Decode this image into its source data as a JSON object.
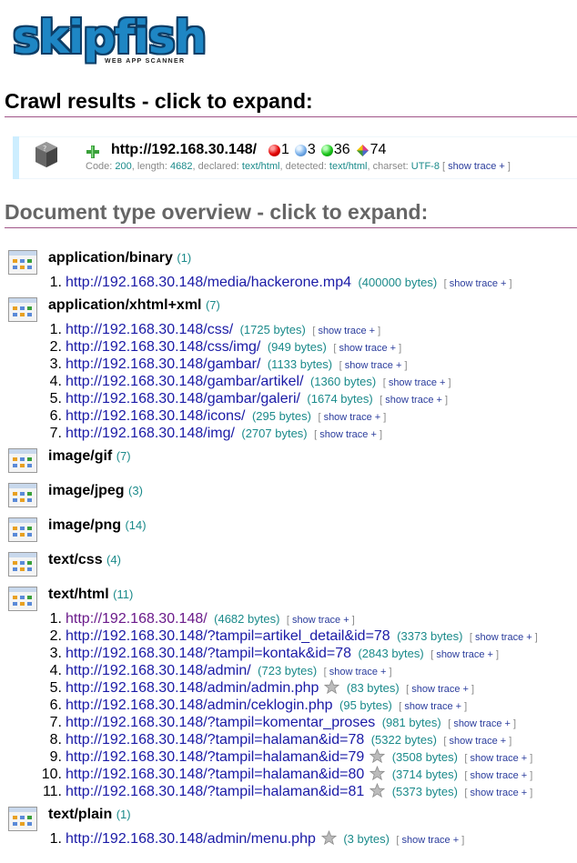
{
  "logo": {
    "name": "skipfish",
    "tagline": "WEB APP SCANNER"
  },
  "crawl": {
    "title": "Crawl results - click to expand:",
    "url": "http://192.168.30.148/",
    "counts": {
      "high": "1",
      "medium": "3",
      "low": "36",
      "notes": "74"
    },
    "meta": {
      "code_label": "Code: ",
      "code": "200",
      "length_label": ", length: ",
      "length": "4682",
      "declared_label": ", declared: ",
      "declared": "text/html",
      "detected_label": ", detected: ",
      "detected": "text/html",
      "charset_label": ", charset: ",
      "charset": "UTF-8"
    },
    "trace_open": "[ ",
    "trace_label": "show trace +",
    "trace_close": " ]"
  },
  "doc": {
    "title": "Document type overview - click to expand:",
    "groups": [
      {
        "type": "application/binary",
        "count": "(1)",
        "items": [
          {
            "n": "1.",
            "url": "http://192.168.30.148/media/hackerone.mp4",
            "size": "(400000 bytes)"
          }
        ]
      },
      {
        "type": "application/xhtml+xml",
        "count": "(7)",
        "items": [
          {
            "n": "1.",
            "url": "http://192.168.30.148/css/",
            "size": "(1725 bytes)"
          },
          {
            "n": "2.",
            "url": "http://192.168.30.148/css/img/",
            "size": "(949 bytes)"
          },
          {
            "n": "3.",
            "url": "http://192.168.30.148/gambar/",
            "size": "(1133 bytes)"
          },
          {
            "n": "4.",
            "url": "http://192.168.30.148/gambar/artikel/",
            "size": "(1360 bytes)"
          },
          {
            "n": "5.",
            "url": "http://192.168.30.148/gambar/galeri/",
            "size": "(1674 bytes)"
          },
          {
            "n": "6.",
            "url": "http://192.168.30.148/icons/",
            "size": "(295 bytes)"
          },
          {
            "n": "7.",
            "url": "http://192.168.30.148/img/",
            "size": "(2707 bytes)"
          }
        ]
      },
      {
        "type": "image/gif",
        "count": "(7)",
        "items": []
      },
      {
        "type": "image/jpeg",
        "count": "(3)",
        "items": []
      },
      {
        "type": "image/png",
        "count": "(14)",
        "items": []
      },
      {
        "type": "text/css",
        "count": "(4)",
        "items": []
      },
      {
        "type": "text/html",
        "count": "(11)",
        "items": [
          {
            "n": "1.",
            "url": "http://192.168.30.148/",
            "size": "(4682 bytes)"
          },
          {
            "n": "2.",
            "url": "http://192.168.30.148/?tampil=artikel_detail&id=78",
            "size": "(3373 bytes)"
          },
          {
            "n": "3.",
            "url": "http://192.168.30.148/?tampil=kontak&id=78",
            "size": "(2843 bytes)"
          },
          {
            "n": "4.",
            "url": "http://192.168.30.148/admin/",
            "size": "(723 bytes)"
          },
          {
            "n": "5.",
            "url": "http://192.168.30.148/admin/admin.php",
            "size": "(83 bytes)",
            "star": true
          },
          {
            "n": "6.",
            "url": "http://192.168.30.148/admin/ceklogin.php",
            "size": "(95 bytes)"
          },
          {
            "n": "7.",
            "url": "http://192.168.30.148/?tampil=komentar_proses",
            "size": "(981 bytes)"
          },
          {
            "n": "8.",
            "url": "http://192.168.30.148/?tampil=halaman&id=78",
            "size": "(5322 bytes)"
          },
          {
            "n": "9.",
            "url": "http://192.168.30.148/?tampil=halaman&id=79",
            "size": "(3508 bytes)",
            "star": true
          },
          {
            "n": "10.",
            "url": "http://192.168.30.148/?tampil=halaman&id=80",
            "size": "(3714 bytes)",
            "star": true
          },
          {
            "n": "11.",
            "url": "http://192.168.30.148/?tampil=halaman&id=81",
            "size": "(5373 bytes)",
            "star": true
          }
        ]
      },
      {
        "type": "text/plain",
        "count": "(1)",
        "items": [
          {
            "n": "1.",
            "url": "http://192.168.30.148/admin/menu.php",
            "size": "(3 bytes)",
            "star": true
          }
        ]
      }
    ]
  },
  "colors": {
    "link": "#1a1aa6",
    "visited": "#6a1a8a",
    "teal": "#1a8a8a",
    "rule": "#a05588",
    "logo": "#1e86c4"
  },
  "icons": {
    "node": "server-node-icon",
    "expand": "plus-icon",
    "high": "red-dot-icon",
    "medium": "blue-dot-icon",
    "low": "green-dot-icon",
    "notes": "note-icon",
    "mime": "document-window-icon",
    "flag": "star-icon"
  }
}
